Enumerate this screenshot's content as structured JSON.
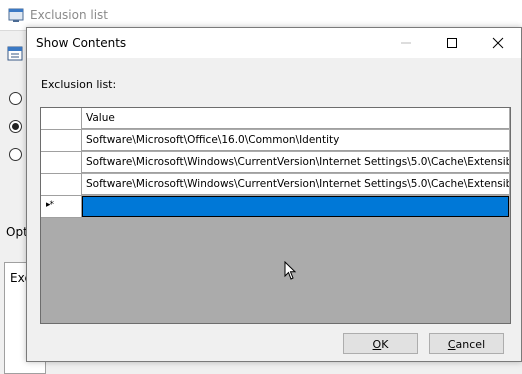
{
  "parent_window": {
    "title": "Exclusion list",
    "options_label": "Opti",
    "box_label": "Exc"
  },
  "dialog": {
    "title": "Show Contents",
    "list_label": "Exclusion list:",
    "grid": {
      "column_header": "Value",
      "rows": [
        "Software\\Microsoft\\Office\\16.0\\Common\\Identity",
        "Software\\Microsoft\\Windows\\CurrentVersion\\Internet Settings\\5.0\\Cache\\Extensible ...",
        "Software\\Microsoft\\Windows\\CurrentVersion\\Internet Settings\\5.0\\Cache\\Extensible ..."
      ],
      "new_row_marker": "▸*"
    },
    "ok_label_mnemonic": "O",
    "ok_label_rest": "K",
    "cancel_label_mnemonic": "C",
    "cancel_label_rest": "ancel"
  },
  "colors": {
    "selection": "#0078d7",
    "grid_background": "#ababab",
    "dialog_background": "#f0f0f0"
  },
  "icons": {
    "app": "app-window-icon",
    "minimize": "minimize-icon",
    "maximize": "maximize-icon",
    "close": "close-icon",
    "cursor": "mouse-cursor-icon"
  }
}
